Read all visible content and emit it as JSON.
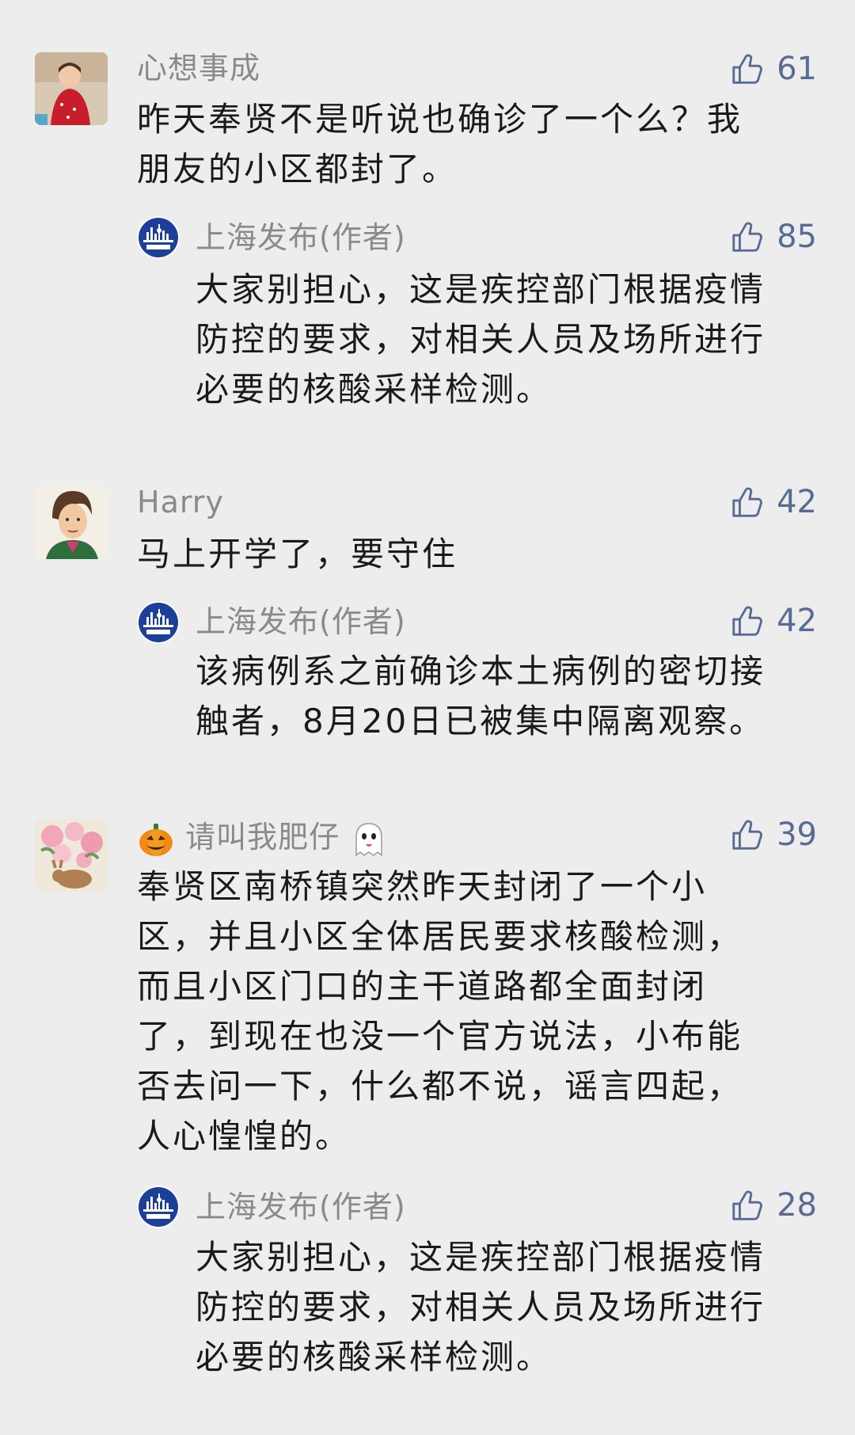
{
  "colors": {
    "background": "#ededed",
    "name": "#8a8a8a",
    "like": "#576b95",
    "text": "#1a1a1a"
  },
  "comments": [
    {
      "name": "心想事成",
      "likes": "61",
      "text_lines": [
        "昨天奉贤不是听说也确诊了一个么？我",
        "朋友的小区都封了。"
      ],
      "reply": {
        "name": "上海发布(作者)",
        "likes": "85",
        "text_lines": [
          "大家别担心，这是疾控部门根据疫情",
          "防控的要求，对相关人员及场所进行",
          "必要的核酸采样检测。"
        ]
      }
    },
    {
      "name": "Harry",
      "likes": "42",
      "text_lines": [
        "马上开学了，要守住"
      ],
      "reply": {
        "name": "上海发布(作者)",
        "likes": "42",
        "text_lines": [
          "该病例系之前确诊本土病例的密切接",
          "触者，8月20日已被集中隔离观察。"
        ]
      }
    },
    {
      "name": "请叫我肥仔",
      "name_prefix_icon": "pumpkin-emoji",
      "name_suffix_icon": "ghost-emoji",
      "likes": "39",
      "text_lines": [
        "奉贤区南桥镇突然昨天封闭了一个小",
        "区，并且小区全体居民要求核酸检测，",
        "而且小区门口的主干道路都全面封闭",
        "了，到现在也没一个官方说法，小布能",
        "否去问一下，什么都不说，谣言四起，",
        "人心惶惶的。"
      ],
      "reply": {
        "name": "上海发布(作者)",
        "likes": "28",
        "text_lines": [
          "大家别担心，这是疾控部门根据疫情",
          "防控的要求，对相关人员及场所进行",
          "必要的核酸采样检测。"
        ]
      }
    }
  ]
}
